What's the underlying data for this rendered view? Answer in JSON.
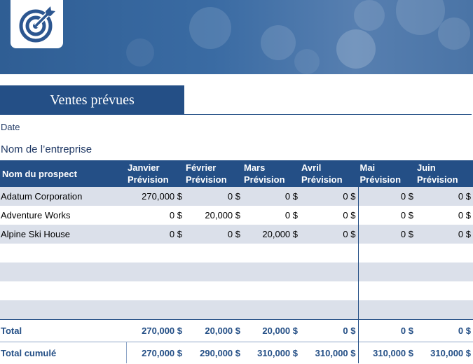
{
  "header": {
    "logo_icon": "target-icon",
    "title": "Ventes prévues",
    "date_label": "Date",
    "company_label": "Nom de l’entreprise"
  },
  "table": {
    "name_header": "Nom du prospect",
    "months": [
      {
        "name": "Janvier",
        "sub": "Prévision"
      },
      {
        "name": "Février",
        "sub": "Prévision"
      },
      {
        "name": "Mars",
        "sub": "Prévision"
      },
      {
        "name": "Avril",
        "sub": "Prévision"
      },
      {
        "name": "Mai",
        "sub": "Prévision"
      },
      {
        "name": "Juin",
        "sub": "Prévision"
      }
    ],
    "rows": [
      {
        "name": "Adatum Corporation",
        "values": [
          "270,000 $",
          "0 $",
          "0 $",
          "0 $",
          "0 $",
          "0 $"
        ]
      },
      {
        "name": "Adventure Works",
        "values": [
          "0 $",
          "20,000 $",
          "0 $",
          "0 $",
          "0 $",
          "0 $"
        ]
      },
      {
        "name": "Alpine Ski House",
        "values": [
          "0 $",
          "0 $",
          "20,000 $",
          "0 $",
          "0 $",
          "0 $"
        ]
      },
      {
        "name": "",
        "values": [
          "",
          "",
          "",
          "",
          "",
          ""
        ]
      },
      {
        "name": "",
        "values": [
          "",
          "",
          "",
          "",
          "",
          ""
        ]
      },
      {
        "name": "",
        "values": [
          "",
          "",
          "",
          "",
          "",
          ""
        ]
      },
      {
        "name": "",
        "values": [
          "",
          "",
          "",
          "",
          "",
          ""
        ]
      }
    ],
    "total": {
      "label": "Total",
      "values": [
        "270,000 $",
        "20,000 $",
        "20,000 $",
        "0 $",
        "0 $",
        "0 $"
      ]
    },
    "cumulative": {
      "label": "Total cumulé",
      "values": [
        "270,000 $",
        "290,000 $",
        "310,000 $",
        "310,000 $",
        "310,000 $",
        "310,000 $"
      ]
    }
  },
  "colors": {
    "accent": "#244f86",
    "band": "#dbe0ea"
  }
}
